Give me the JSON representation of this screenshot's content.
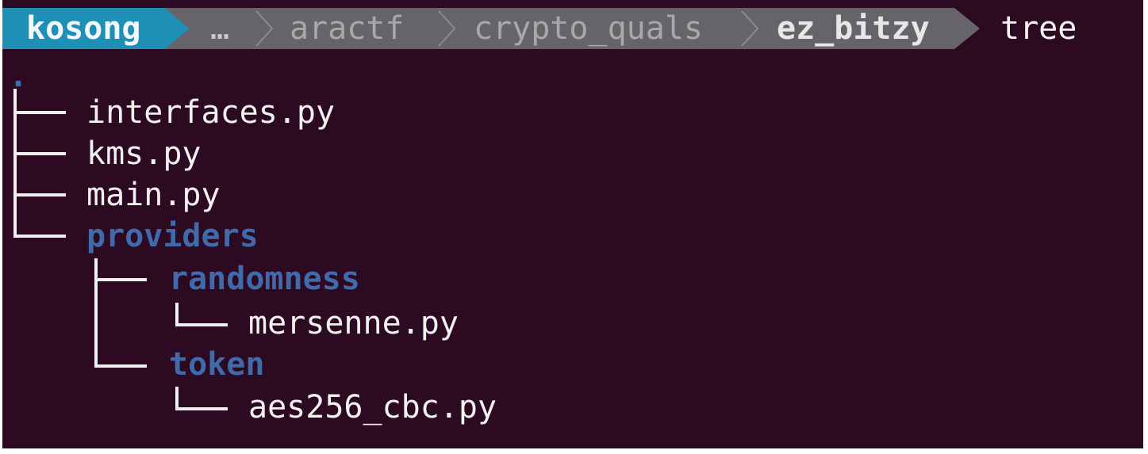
{
  "prompt": {
    "user": "kosong",
    "ellipsis": "…",
    "path_segments": [
      "aractf",
      "crypto_quals"
    ],
    "current_dir": "ez_bitzy",
    "command": "tree"
  },
  "tree": {
    "root": ".",
    "items": [
      {
        "name": "interfaces.py",
        "kind": "file"
      },
      {
        "name": "kms.py",
        "kind": "file"
      },
      {
        "name": "main.py",
        "kind": "file"
      },
      {
        "name": "providers",
        "kind": "directory"
      },
      {
        "name": "randomness",
        "kind": "directory"
      },
      {
        "name": "mersenne.py",
        "kind": "file"
      },
      {
        "name": "token",
        "kind": "directory"
      },
      {
        "name": "aes256_cbc.py",
        "kind": "file"
      }
    ]
  },
  "colors": {
    "background": "#2c0a22",
    "user_segment": "#1e8fb5",
    "path_segment": "#666468",
    "path_text": "#a9a7a7",
    "current_dir_text": "#e8e6e6",
    "directory_text": "#3f6aab",
    "file_text": "#f3f1f0"
  }
}
